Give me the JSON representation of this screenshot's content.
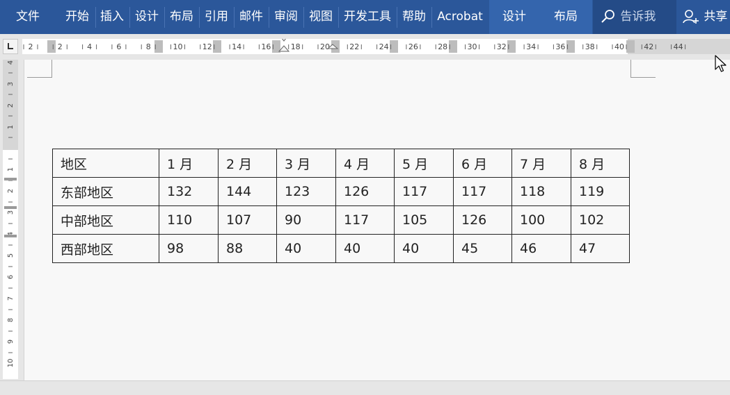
{
  "ribbon": {
    "tabs": [
      "文件",
      "开始",
      "插入",
      "设计",
      "布局",
      "引用",
      "邮件",
      "审阅",
      "视图",
      "开发工具",
      "帮助",
      "Acrobat"
    ],
    "context_tabs": [
      "设计",
      "布局"
    ],
    "tell_me": "告诉我",
    "share": "共享"
  },
  "ruler": {
    "h_labels": [
      "2",
      "2",
      "4",
      "6",
      "8",
      "10",
      "12",
      "14",
      "16",
      "18",
      "20",
      "22",
      "24",
      "26",
      "28",
      "30",
      "32",
      "34",
      "36",
      "38",
      "40",
      "42",
      "44"
    ],
    "v_labels_top": [
      "4",
      "3",
      "2",
      "1"
    ],
    "v_labels_bottom": [
      "1",
      "2",
      "3",
      "4",
      "5",
      "6",
      "7",
      "8",
      "9",
      "10"
    ]
  },
  "table": {
    "header": [
      "地区",
      "1 月",
      "2 月",
      "3 月",
      "4 月",
      "5 月",
      "6 月",
      "7 月",
      "8 月"
    ],
    "rows": [
      [
        "东部地区",
        "132",
        "144",
        "123",
        "126",
        "117",
        "117",
        "118",
        "119"
      ],
      [
        "中部地区",
        "110",
        "107",
        "90",
        "117",
        "105",
        "126",
        "100",
        "102"
      ],
      [
        "西部地区",
        "98",
        "88",
        "40",
        "40",
        "40",
        "45",
        "46",
        "47"
      ]
    ]
  },
  "colors": {
    "ribbon": "#2b579a",
    "context_tab": "#3465ad",
    "page": "#f8f8f8"
  }
}
